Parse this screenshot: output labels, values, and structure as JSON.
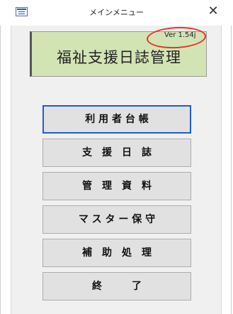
{
  "window": {
    "title": "メインメニュー",
    "close_glyph": "✕"
  },
  "header": {
    "title": "福祉支援日誌管理",
    "version": "Ver 1.54j"
  },
  "menu": {
    "buttons": [
      {
        "label": "利 用 者 台 帳"
      },
      {
        "label": "支　援　日　誌"
      },
      {
        "label": "管　理　資　料"
      },
      {
        "label": "マ ス タ ー 保 守"
      },
      {
        "label": "補　助　処　理"
      },
      {
        "label": "終　　　了"
      }
    ]
  },
  "colors": {
    "header_bg": "#d3e4b4",
    "annotation": "#e8322a",
    "focus_border": "#1e5fc9"
  }
}
